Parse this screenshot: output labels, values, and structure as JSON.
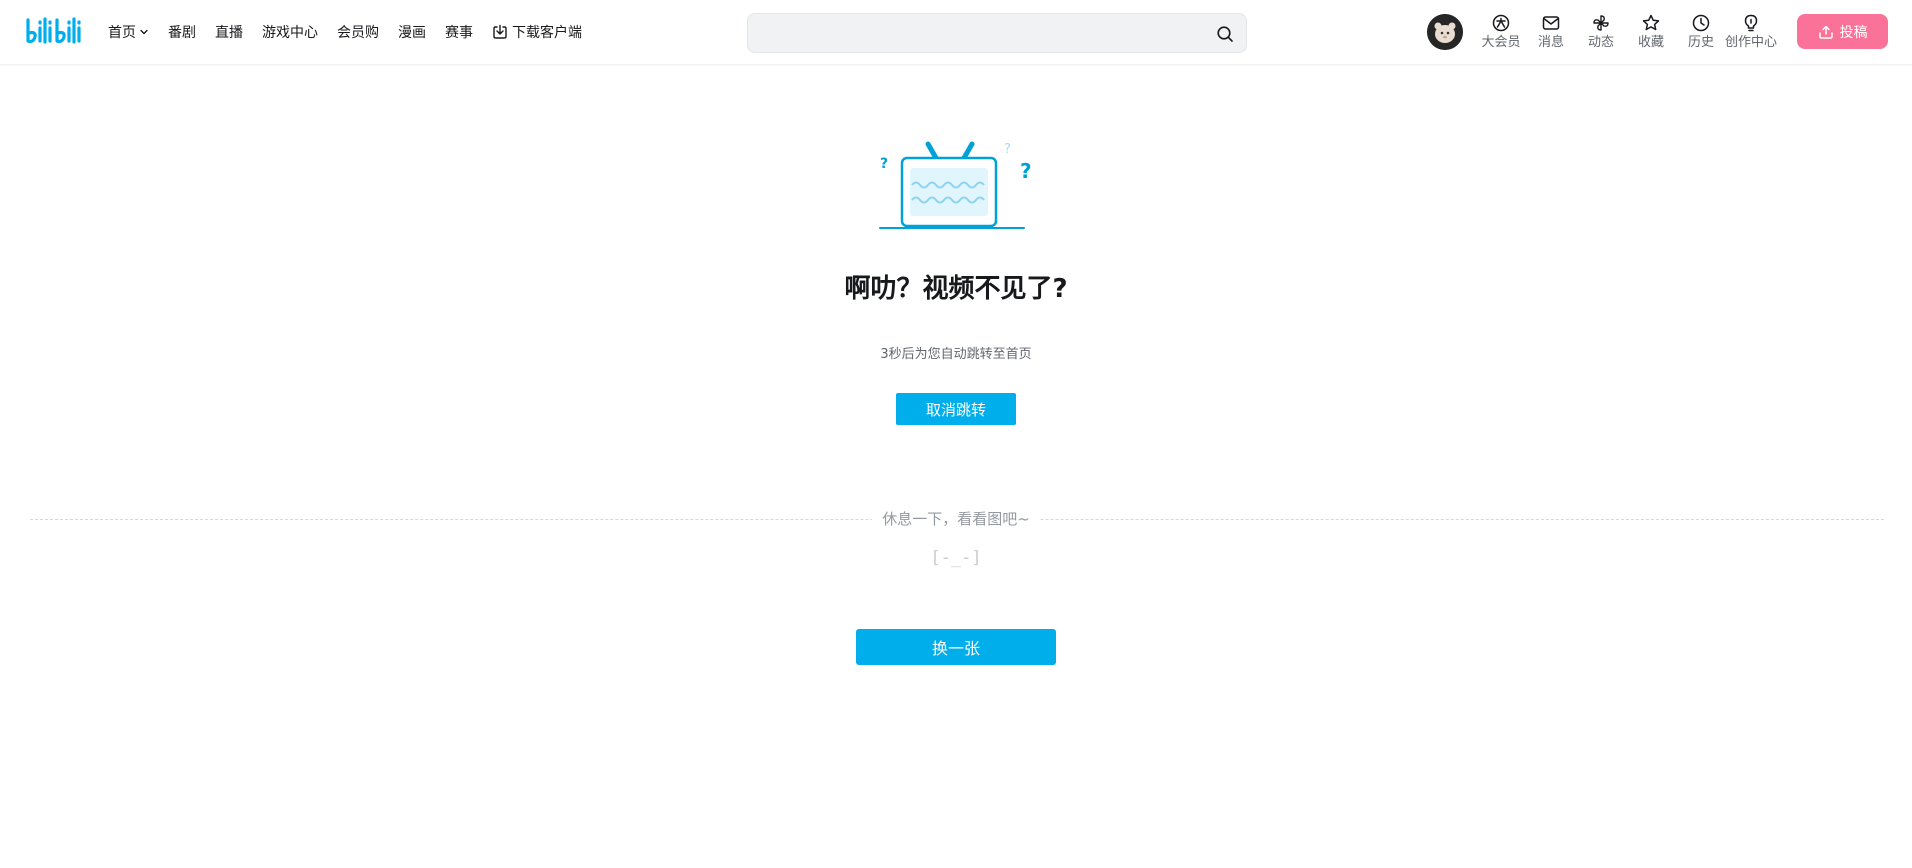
{
  "header": {
    "logo_text": "bilibili",
    "nav": [
      {
        "label": "首页",
        "has_dropdown": true
      },
      {
        "label": "番剧"
      },
      {
        "label": "直播"
      },
      {
        "label": "游戏中心"
      },
      {
        "label": "会员购"
      },
      {
        "label": "漫画"
      },
      {
        "label": "赛事"
      },
      {
        "label": "下载客户端",
        "icon": "download-icon"
      }
    ],
    "search": {
      "value": "",
      "placeholder": ""
    },
    "entries": [
      {
        "label": "大会员",
        "icon": "vip-icon"
      },
      {
        "label": "消息",
        "icon": "message-icon"
      },
      {
        "label": "动态",
        "icon": "dynamic-icon"
      },
      {
        "label": "收藏",
        "icon": "star-icon"
      },
      {
        "label": "历史",
        "icon": "history-icon"
      },
      {
        "label": "创作中心",
        "icon": "bulb-icon"
      }
    ],
    "upload_label": "投稿"
  },
  "error": {
    "title": "啊叻？视频不见了?",
    "subtitle": "3秒后为您自动跳转至首页",
    "cancel_label": "取消跳转"
  },
  "rest": {
    "divider_text": "休息一下，看看图吧~",
    "emote": "[-_-]",
    "change_label": "换一张"
  },
  "colors": {
    "brand_blue": "#00aeec",
    "upload_pink": "#fb7299",
    "text_primary": "#18191c",
    "text_secondary": "#61666d",
    "text_muted": "#9499a0"
  }
}
